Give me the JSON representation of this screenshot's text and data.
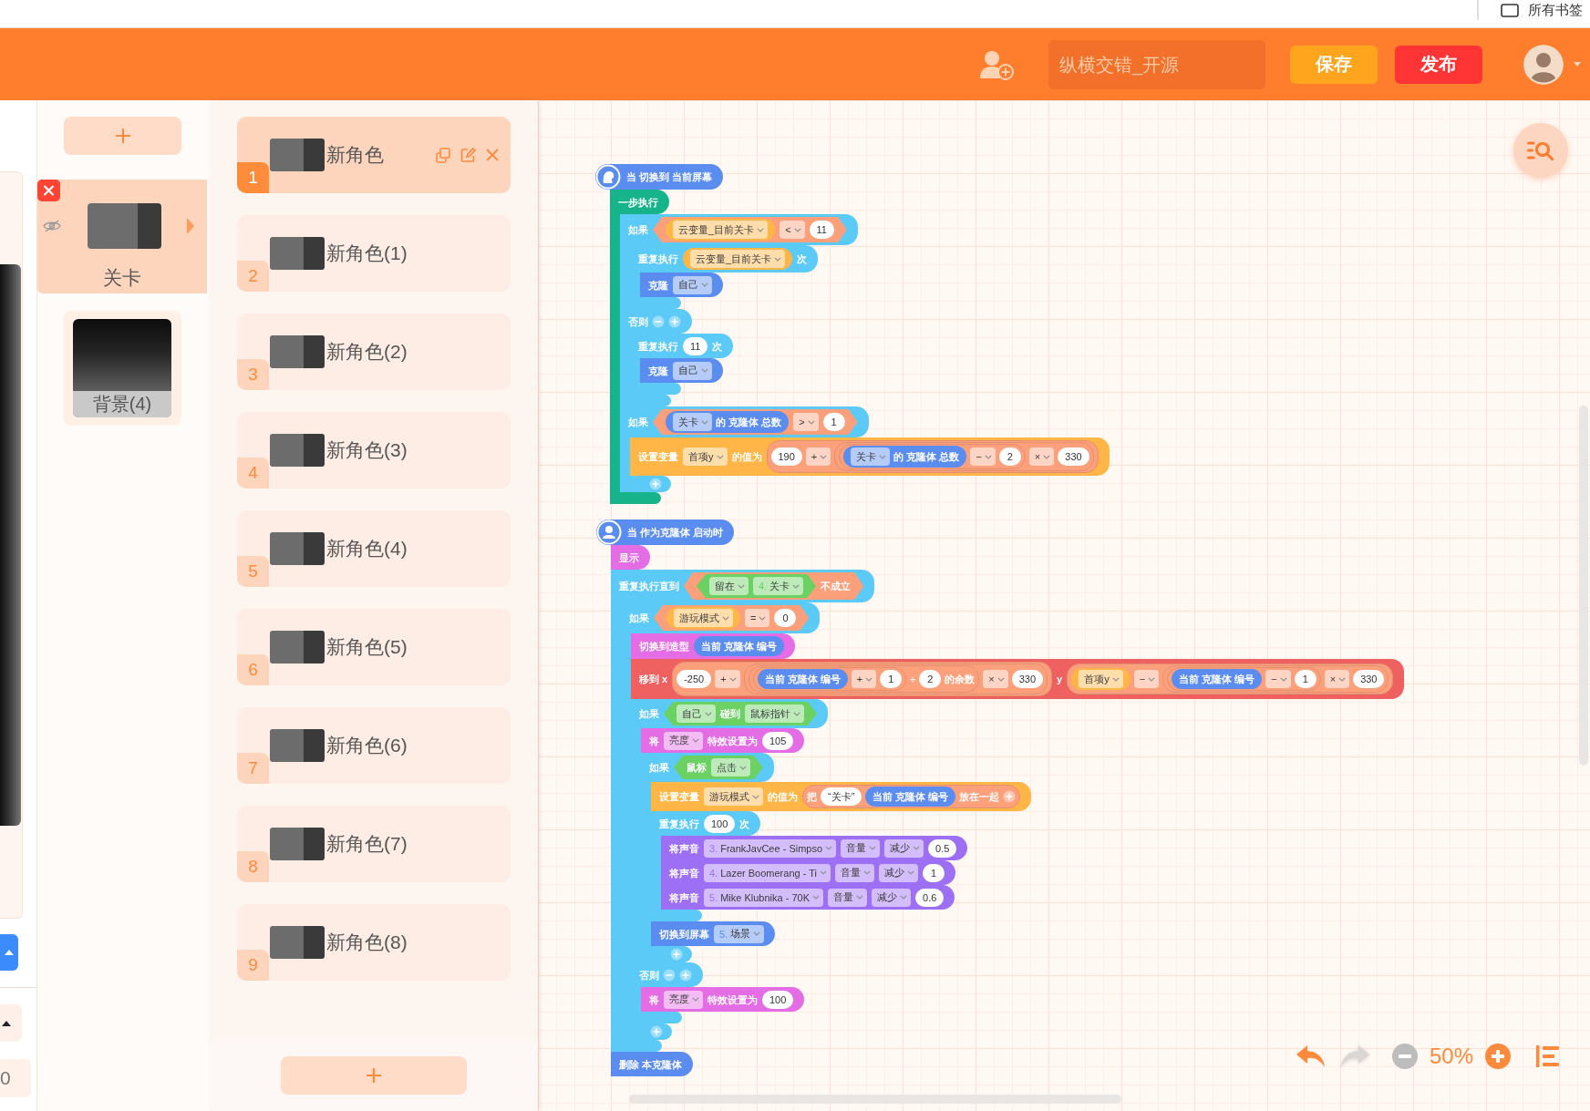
{
  "browser_bar": {
    "bookmarks_label": "所有书签"
  },
  "header": {
    "project_name": "纵横交错_开源",
    "buttons": [
      {
        "kind": "save",
        "label": "保存"
      },
      {
        "kind": "publish",
        "label": "发布"
      }
    ]
  },
  "stage_panel": {
    "field_value": "0"
  },
  "screens": {
    "items": [
      {
        "name": "关卡",
        "selected": true
      },
      {
        "name": "背景(4)",
        "selected": false
      }
    ]
  },
  "sprites": {
    "items": [
      {
        "number": "1",
        "name": "新角色",
        "selected": true
      },
      {
        "number": "2",
        "name": "新角色(1)",
        "selected": false
      },
      {
        "number": "3",
        "name": "新角色(2)",
        "selected": false
      },
      {
        "number": "4",
        "name": "新角色(3)",
        "selected": false
      },
      {
        "number": "5",
        "name": "新角色(4)",
        "selected": false
      },
      {
        "number": "6",
        "name": "新角色(5)",
        "selected": false
      },
      {
        "number": "7",
        "name": "新角色(6)",
        "selected": false
      },
      {
        "number": "8",
        "name": "新角色(7)",
        "selected": false
      },
      {
        "number": "9",
        "name": "新角色(8)",
        "selected": false
      }
    ]
  },
  "canvas": {
    "scripts": [
      {
        "blocks": [
          {
            "kind": "screenhat",
            "color": "#5b8cf0",
            "parts": [
              {
                "kind": "label",
                "text": "当 切换到 当前屏幕"
              }
            ]
          },
          {
            "kind": "c",
            "color": "#17b38b",
            "parts": [
              {
                "kind": "label",
                "text": "一步执行"
              }
            ],
            "body": [
              {
                "kind": "ifelse",
                "color": "#5ccaf7",
                "parts": [
                  {
                    "kind": "label",
                    "text": "如果"
                  },
                  {
                    "kind": "boolean",
                    "color": "#fca07c",
                    "parts": [
                      {
                        "kind": "reporter",
                        "color": "#ffb646",
                        "parts": [
                          {
                            "kind": "menu",
                            "text": "云变量_目前关卡"
                          }
                        ]
                      },
                      {
                        "kind": "menu",
                        "text": "<"
                      },
                      {
                        "kind": "value",
                        "text": "11"
                      }
                    ]
                  }
                ],
                "body": [
                  {
                    "kind": "c",
                    "color": "#5ccaf7",
                    "parts": [
                      {
                        "kind": "label",
                        "text": "重复执行"
                      },
                      {
                        "kind": "reporter",
                        "color": "#ffb646",
                        "parts": [
                          {
                            "kind": "menu",
                            "text": "云变量_目前关卡"
                          }
                        ]
                      },
                      {
                        "kind": "label",
                        "text": "次"
                      }
                    ],
                    "body": [
                      {
                        "kind": "command",
                        "color": "#5b8cf0",
                        "parts": [
                          {
                            "kind": "label",
                            "text": "克隆"
                          },
                          {
                            "kind": "menu",
                            "text": "自己"
                          }
                        ]
                      }
                    ]
                  }
                ],
                "else_parts": [
                  {
                    "kind": "label",
                    "text": "否则"
                  },
                  {
                    "kind": "remove"
                  },
                  {
                    "kind": "add"
                  }
                ],
                "else_body": [
                  {
                    "kind": "c",
                    "color": "#5ccaf7",
                    "parts": [
                      {
                        "kind": "label",
                        "text": "重复执行"
                      },
                      {
                        "kind": "value",
                        "text": "11"
                      },
                      {
                        "kind": "label",
                        "text": "次"
                      }
                    ],
                    "body": [
                      {
                        "kind": "command",
                        "color": "#5b8cf0",
                        "parts": [
                          {
                            "kind": "label",
                            "text": "克隆"
                          },
                          {
                            "kind": "menu",
                            "text": "自己"
                          }
                        ]
                      }
                    ]
                  }
                ]
              },
              {
                "kind": "c",
                "color": "#5ccaf7",
                "parts": [
                  {
                    "kind": "label",
                    "text": "如果"
                  },
                  {
                    "kind": "boolean",
                    "color": "#fca07c",
                    "parts": [
                      {
                        "kind": "reporter",
                        "color": "#5b8cf0",
                        "parts": [
                          {
                            "kind": "menu",
                            "text": "关卡"
                          },
                          {
                            "kind": "label",
                            "text": "的 克隆体 总数"
                          }
                        ]
                      },
                      {
                        "kind": "menu",
                        "text": ">"
                      },
                      {
                        "kind": "value",
                        "text": "1"
                      }
                    ]
                  }
                ],
                "body": [
                  {
                    "kind": "command",
                    "color": "#ffb646",
                    "parts": [
                      {
                        "kind": "label",
                        "text": "设置变量"
                      },
                      {
                        "kind": "menu",
                        "text": "首项y"
                      },
                      {
                        "kind": "label",
                        "text": "的值为"
                      },
                      {
                        "kind": "group",
                        "color": "#fca07c",
                        "parts": [
                          {
                            "kind": "value",
                            "text": "190"
                          },
                          {
                            "kind": "menu",
                            "text": "+"
                          },
                          {
                            "kind": "group",
                            "color": "#fca07c",
                            "parts": [
                              {
                                "kind": "group",
                                "color": "#fca07c",
                                "parts": [
                                  {
                                    "kind": "reporter",
                                    "color": "#5b8cf0",
                                    "parts": [
                                      {
                                        "kind": "menu",
                                        "text": "关卡"
                                      },
                                      {
                                        "kind": "label",
                                        "text": "的 克隆体 总数"
                                      }
                                    ]
                                  },
                                  {
                                    "kind": "menu",
                                    "text": "−"
                                  },
                                  {
                                    "kind": "value",
                                    "text": "2"
                                  }
                                ]
                              },
                              {
                                "kind": "menu",
                                "text": "×"
                              },
                              {
                                "kind": "value",
                                "text": "330"
                              }
                            ]
                          }
                        ]
                      }
                    ]
                  }
                ],
                "foot_parts": [
                  {
                    "kind": "add"
                  }
                ]
              }
            ]
          }
        ]
      },
      {
        "blocks": [
          {
            "kind": "clonehat",
            "color": "#5b8cf0",
            "parts": [
              {
                "kind": "label",
                "text": "当 作为克隆体 启动时"
              }
            ]
          },
          {
            "kind": "command",
            "color": "#e46ce5",
            "parts": [
              {
                "kind": "label",
                "text": "显示"
              }
            ]
          },
          {
            "kind": "c",
            "color": "#5ccaf7",
            "parts": [
              {
                "kind": "label",
                "text": "重复执行直到"
              },
              {
                "kind": "boolean",
                "color": "#fca07c",
                "parts": [
                  {
                    "kind": "boolean",
                    "color": "#6bd163",
                    "parts": [
                      {
                        "kind": "menu",
                        "text": "留在"
                      },
                      {
                        "kind": "menu",
                        "index": "4.",
                        "text": "关卡"
                      }
                    ]
                  },
                  {
                    "kind": "label",
                    "text": "不成立"
                  }
                ]
              }
            ],
            "body": [
              {
                "kind": "c",
                "color": "#5ccaf7",
                "parts": [
                  {
                    "kind": "label",
                    "text": "如果"
                  },
                  {
                    "kind": "boolean",
                    "color": "#fca07c",
                    "parts": [
                      {
                        "kind": "reporter",
                        "color": "#ffb646",
                        "parts": [
                          {
                            "kind": "menu",
                            "text": "游玩模式"
                          }
                        ]
                      },
                      {
                        "kind": "menu",
                        "text": "="
                      },
                      {
                        "kind": "value",
                        "text": "0"
                      }
                    ]
                  }
                ],
                "body": [
                  {
                    "kind": "command",
                    "color": "#e46ce5",
                    "parts": [
                      {
                        "kind": "label",
                        "text": "切换到造型"
                      },
                      {
                        "kind": "reporter",
                        "color": "#5b8cf0",
                        "parts": [
                          {
                            "kind": "label",
                            "text": "当前 克隆体 编号"
                          }
                        ]
                      }
                    ]
                  },
                  {
                    "kind": "command",
                    "color": "#ef6060",
                    "parts": [
                      {
                        "kind": "label",
                        "text": "移到 x"
                      },
                      {
                        "kind": "group",
                        "color": "#fca07c",
                        "parts": [
                          {
                            "kind": "value",
                            "text": "-250"
                          },
                          {
                            "kind": "menu",
                            "text": "+"
                          },
                          {
                            "kind": "group",
                            "color": "#fca07c",
                            "parts": [
                              {
                                "kind": "group",
                                "color": "#fca07c",
                                "parts": [
                                  {
                                    "kind": "group",
                                    "color": "#fca07c",
                                    "parts": [
                                      {
                                        "kind": "reporter",
                                        "color": "#5b8cf0",
                                        "parts": [
                                          {
                                            "kind": "label",
                                            "text": "当前 克隆体 编号"
                                          }
                                        ]
                                      },
                                      {
                                        "kind": "menu",
                                        "text": "+"
                                      },
                                      {
                                        "kind": "value",
                                        "text": "1"
                                      }
                                    ]
                                  },
                                  {
                                    "kind": "label",
                                    "text": "÷"
                                  },
                                  {
                                    "kind": "value",
                                    "text": "2"
                                  },
                                  {
                                    "kind": "label",
                                    "text": "的余数"
                                  }
                                ]
                              },
                              {
                                "kind": "menu",
                                "text": "×"
                              },
                              {
                                "kind": "value",
                                "text": "330"
                              }
                            ]
                          }
                        ]
                      },
                      {
                        "kind": "label",
                        "text": "y"
                      },
                      {
                        "kind": "group",
                        "color": "#fca07c",
                        "parts": [
                          {
                            "kind": "reporter",
                            "color": "#ffb646",
                            "parts": [
                              {
                                "kind": "menu",
                                "text": "首项y"
                              }
                            ]
                          },
                          {
                            "kind": "menu",
                            "text": "−"
                          },
                          {
                            "kind": "group",
                            "color": "#fca07c",
                            "parts": [
                              {
                                "kind": "group",
                                "color": "#fca07c",
                                "parts": [
                                  {
                                    "kind": "reporter",
                                    "color": "#5b8cf0",
                                    "parts": [
                                      {
                                        "kind": "label",
                                        "text": "当前 克隆体 编号"
                                      }
                                    ]
                                  },
                                  {
                                    "kind": "menu",
                                    "text": "−"
                                  },
                                  {
                                    "kind": "value",
                                    "text": "1"
                                  }
                                ]
                              },
                              {
                                "kind": "menu",
                                "text": "×"
                              },
                              {
                                "kind": "value",
                                "text": "330"
                              }
                            ]
                          }
                        ]
                      }
                    ]
                  },
                  {
                    "kind": "ifelse",
                    "color": "#5ccaf7",
                    "parts": [
                      {
                        "kind": "label",
                        "text": "如果"
                      },
                      {
                        "kind": "boolean",
                        "color": "#6bd163",
                        "parts": [
                          {
                            "kind": "menu",
                            "text": "自己"
                          },
                          {
                            "kind": "label",
                            "text": "碰到"
                          },
                          {
                            "kind": "menu",
                            "text": "鼠标指针"
                          }
                        ]
                      }
                    ],
                    "body": [
                      {
                        "kind": "command",
                        "color": "#e46ce5",
                        "parts": [
                          {
                            "kind": "label",
                            "text": "将"
                          },
                          {
                            "kind": "menu",
                            "text": "亮度"
                          },
                          {
                            "kind": "label",
                            "text": "特效设置为"
                          },
                          {
                            "kind": "value",
                            "text": "105"
                          }
                        ]
                      },
                      {
                        "kind": "c",
                        "color": "#5ccaf7",
                        "parts": [
                          {
                            "kind": "label",
                            "text": "如果"
                          },
                          {
                            "kind": "boolean",
                            "color": "#6bd163",
                            "parts": [
                              {
                                "kind": "label",
                                "text": "鼠标"
                              },
                              {
                                "kind": "menu",
                                "text": "点击"
                              }
                            ]
                          }
                        ],
                        "body": [
                          {
                            "kind": "command",
                            "color": "#ffb646",
                            "parts": [
                              {
                                "kind": "label",
                                "text": "设置变量"
                              },
                              {
                                "kind": "menu",
                                "text": "游玩模式"
                              },
                              {
                                "kind": "label",
                                "text": "的值为"
                              },
                              {
                                "kind": "group",
                                "color": "#fca07c",
                                "parts": [
                                  {
                                    "kind": "label",
                                    "text": "把"
                                  },
                                  {
                                    "kind": "value",
                                    "text": "“关卡”"
                                  },
                                  {
                                    "kind": "reporter",
                                    "color": "#5b8cf0",
                                    "parts": [
                                      {
                                        "kind": "label",
                                        "text": "当前 克隆体 编号"
                                      }
                                    ]
                                  },
                                  {
                                    "kind": "label",
                                    "text": "放在一起"
                                  },
                                  {
                                    "kind": "add"
                                  }
                                ]
                              }
                            ]
                          },
                          {
                            "kind": "c",
                            "color": "#5ccaf7",
                            "parts": [
                              {
                                "kind": "label",
                                "text": "重复执行"
                              },
                              {
                                "kind": "value",
                                "text": "100"
                              },
                              {
                                "kind": "label",
                                "text": "次"
                              }
                            ],
                            "body": [
                              {
                                "kind": "command",
                                "color": "#9d6ff5",
                                "parts": [
                                  {
                                    "kind": "label",
                                    "text": "将声音"
                                  },
                                  {
                                    "kind": "menu",
                                    "index": "3.",
                                    "text": "FrankJavCee - Simpso"
                                  },
                                  {
                                    "kind": "menu",
                                    "text": "音量"
                                  },
                                  {
                                    "kind": "menu",
                                    "text": "减少"
                                  },
                                  {
                                    "kind": "value",
                                    "text": "0.5"
                                  }
                                ]
                              },
                              {
                                "kind": "command",
                                "color": "#9d6ff5",
                                "parts": [
                                  {
                                    "kind": "label",
                                    "text": "将声音"
                                  },
                                  {
                                    "kind": "menu",
                                    "index": "4.",
                                    "text": "Lazer Boomerang - Ti"
                                  },
                                  {
                                    "kind": "menu",
                                    "text": "音量"
                                  },
                                  {
                                    "kind": "menu",
                                    "text": "减少"
                                  },
                                  {
                                    "kind": "value",
                                    "text": "1"
                                  }
                                ]
                              },
                              {
                                "kind": "command",
                                "color": "#9d6ff5",
                                "parts": [
                                  {
                                    "kind": "label",
                                    "text": "将声音"
                                  },
                                  {
                                    "kind": "menu",
                                    "index": "5.",
                                    "text": "Mike Klubnika - 70K"
                                  },
                                  {
                                    "kind": "menu",
                                    "text": "音量"
                                  },
                                  {
                                    "kind": "menu",
                                    "text": "减少"
                                  },
                                  {
                                    "kind": "value",
                                    "text": "0.6"
                                  }
                                ]
                              }
                            ]
                          },
                          {
                            "kind": "command",
                            "color": "#5b8cf0",
                            "parts": [
                              {
                                "kind": "label",
                                "text": "切换到屏幕"
                              },
                              {
                                "kind": "menu",
                                "index": "5.",
                                "text": "场景"
                              }
                            ]
                          }
                        ],
                        "foot_parts": [
                          {
                            "kind": "add"
                          }
                        ]
                      }
                    ],
                    "else_parts": [
                      {
                        "kind": "label",
                        "text": "否则"
                      },
                      {
                        "kind": "remove"
                      },
                      {
                        "kind": "add"
                      }
                    ],
                    "else_body": [
                      {
                        "kind": "command",
                        "color": "#e46ce5",
                        "parts": [
                          {
                            "kind": "label",
                            "text": "将"
                          },
                          {
                            "kind": "menu",
                            "text": "亮度"
                          },
                          {
                            "kind": "label",
                            "text": "特效设置为"
                          },
                          {
                            "kind": "value",
                            "text": "100"
                          }
                        ]
                      }
                    ]
                  }
                ],
                "foot_parts": [
                  {
                    "kind": "add"
                  }
                ]
              }
            ]
          },
          {
            "kind": "command",
            "color": "#5b8cf0",
            "parts": [
              {
                "kind": "label",
                "text": "删除 本克隆体"
              }
            ]
          }
        ]
      }
    ],
    "history": [
      {
        "kind": "undo",
        "disabled": false
      },
      {
        "kind": "redo",
        "disabled": true
      }
    ],
    "zoom": {
      "out_disabled": true,
      "label": "50%",
      "in_disabled": false
    }
  }
}
